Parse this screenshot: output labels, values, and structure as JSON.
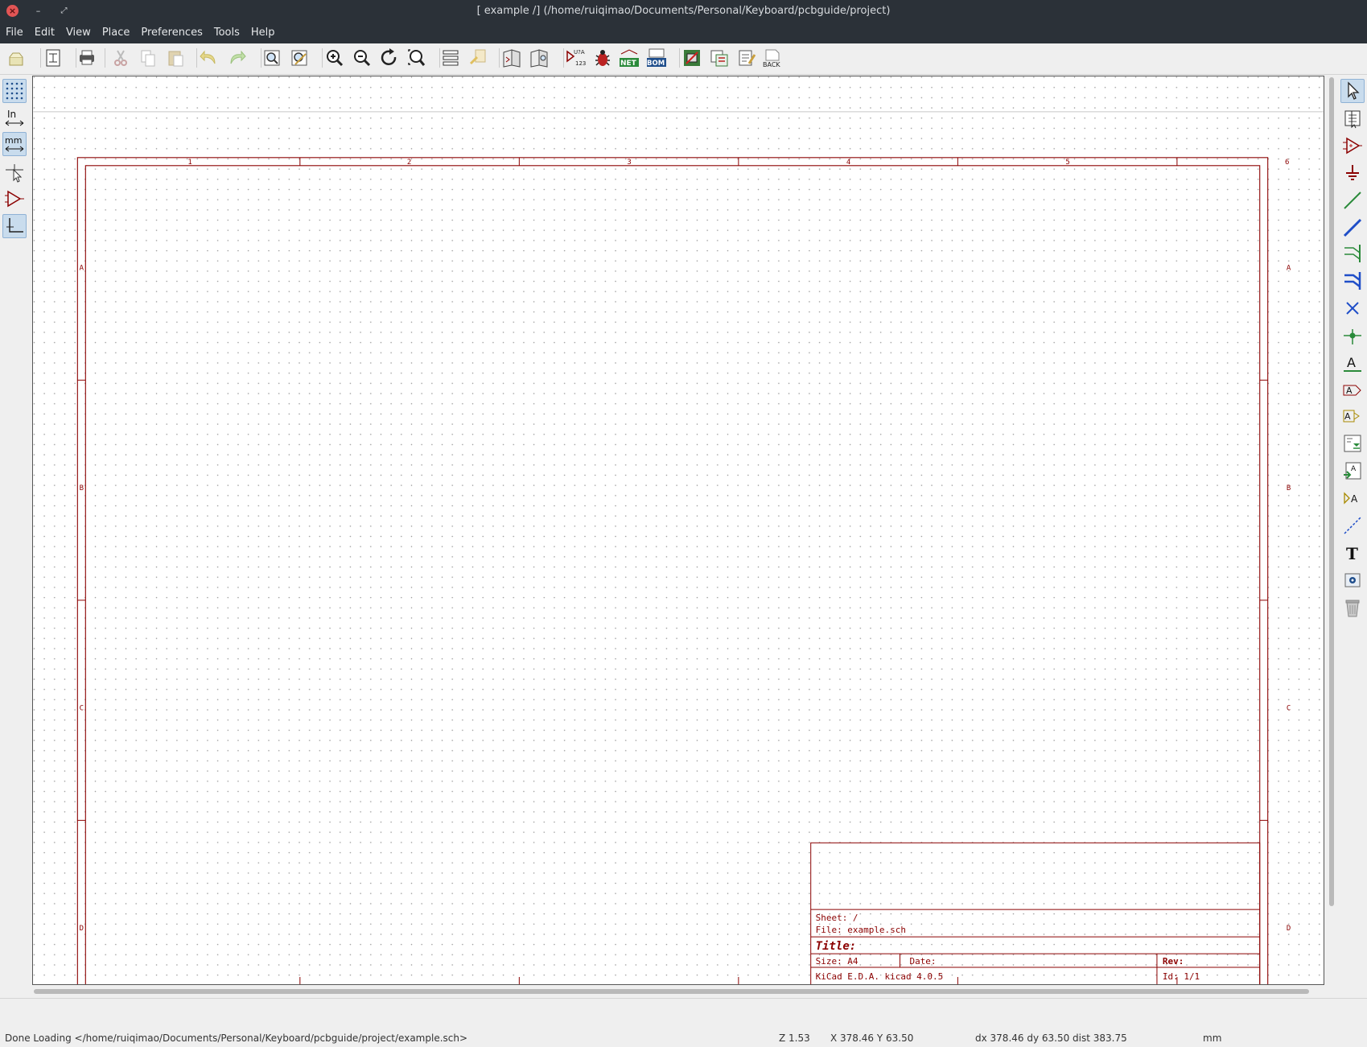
{
  "window": {
    "title": "[ example /] (/home/ruiqimao/Documents/Personal/Keyboard/pcbguide/project)",
    "close_glyph": "×",
    "minimize_glyph": "–",
    "maximize_glyph": "⤢"
  },
  "menu": [
    "File",
    "Edit",
    "View",
    "Place",
    "Preferences",
    "Tools",
    "Help"
  ],
  "toolbar": {
    "icons": [
      "new-schematic-icon",
      "page-settings-icon",
      "print-icon",
      "cut-icon",
      "copy-icon",
      "paste-icon",
      "undo-icon",
      "redo-icon",
      "find-icon",
      "find-replace-icon",
      "zoom-in-icon",
      "zoom-out-icon",
      "redraw-icon",
      "zoom-fit-icon",
      "hierarchy-navigator-icon",
      "leave-sheet-icon",
      "library-editor-icon",
      "library-browser-icon",
      "annotate-icon",
      "erc-icon",
      "netlist-icon",
      "bom-icon",
      "cvpcb-icon",
      "pcbnew-icon",
      "import-footprint-assignment-icon",
      "back-to-pcb-icon"
    ],
    "annotate_top": "U?A",
    "annotate_bottom": "123",
    "net_label": "NET",
    "bom_label": "BOM",
    "back_label": "BACK"
  },
  "left_toolbar": {
    "inch_label": "In",
    "mm_label": "mm"
  },
  "right_toolbar": {
    "icons": [
      "select-arrow-icon",
      "hierarchy-sheet-navigate-icon",
      "place-component-icon",
      "place-power-icon",
      "place-wire-icon",
      "place-bus-icon",
      "wire-to-bus-entry-icon",
      "bus-to-bus-entry-icon",
      "no-connect-flag-icon",
      "junction-icon",
      "net-label-icon",
      "global-label-icon",
      "hierarchical-label-icon",
      "hierarchical-sheet-icon",
      "import-sheet-pin-icon",
      "add-sheet-pin-icon",
      "graphic-line-icon",
      "text-icon",
      "image-icon",
      "delete-icon"
    ],
    "label_glyph": "A",
    "text_glyph": "T"
  },
  "sheet": {
    "columns": [
      "1",
      "2",
      "3",
      "4",
      "5",
      "6"
    ],
    "rows": [
      "A",
      "B",
      "C",
      "D"
    ],
    "title_block": {
      "sheet": "Sheet: /",
      "file": "File: example.sch",
      "title": "Title:",
      "size": "Size: A4",
      "date": "Date:",
      "rev": "Rev:",
      "generator": "KiCad E.D.A.  kicad 4.0.5",
      "id": "Id: 1/1"
    }
  },
  "colors": {
    "frame": "#8b0000",
    "grid_dot": "#9a9a9a",
    "titlebar": "#2b3138"
  },
  "message": "",
  "status": {
    "file_msg": "Done Loading </home/ruiqimao/Documents/Personal/Keyboard/pcbguide/project/example.sch>",
    "zoom": "Z 1.53",
    "coords": "X 378.46  Y 63.50",
    "delta": "dx 378.46  dy 63.50  dist 383.75",
    "units": "mm"
  }
}
